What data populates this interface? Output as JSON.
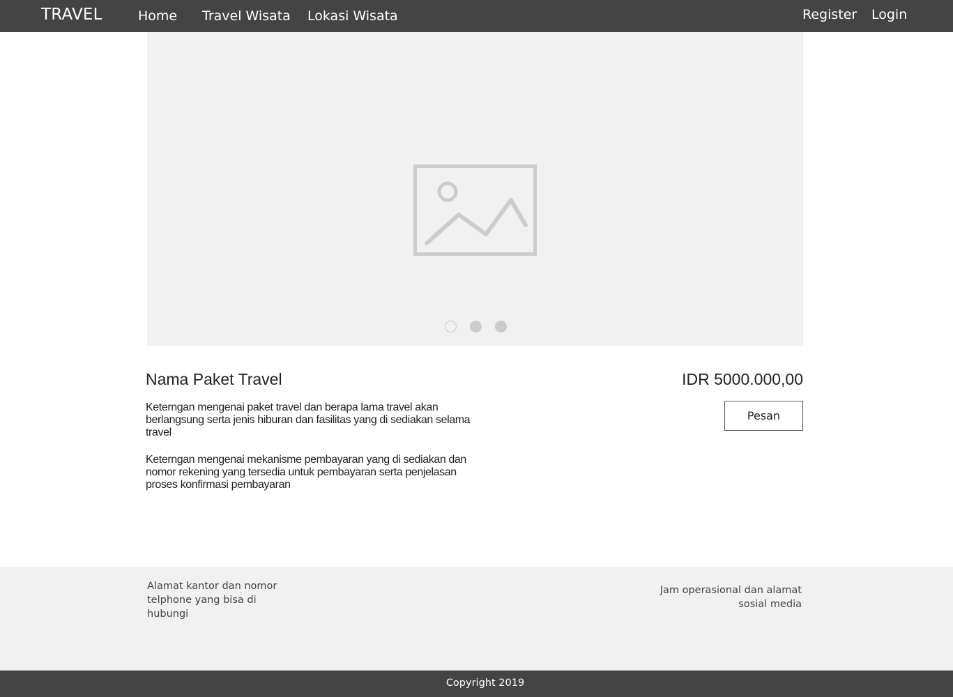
{
  "navbar": {
    "brand": "TRAVEL",
    "links": [
      "Home",
      "Travel Wisata",
      "Lokasi Wisata"
    ],
    "auth": [
      "Register",
      "Login"
    ]
  },
  "carousel": {
    "image_icon": "image-placeholder-icon",
    "slide_count": 3,
    "active_slide": 1
  },
  "package": {
    "title": "Nama Paket Travel",
    "price": "IDR 5000.000,00",
    "description_1": "Keterngan mengenai paket travel dan berapa lama travel akan berlangsung serta jenis hiburan dan fasilitas yang di sediakan selama travel",
    "description_2": "Keterngan mengenai mekanisme pembayaran yang di sediakan dan nomor rekening yang tersedia untuk pembayaran serta penjelasan proses konfirmasi pembayaran",
    "order_button": "Pesan"
  },
  "footer": {
    "left_text": "Alamat kantor dan nomor telphone yang bisa di hubungi",
    "right_text": "Jam operasional dan alamat sosial media",
    "copyright": "Copyright 2019"
  },
  "colors": {
    "navbar_bg": "#444444",
    "carousel_bg": "#f1f1f1",
    "footer_bg": "#f1f1f1",
    "placeholder_gray": "#cccccc"
  }
}
